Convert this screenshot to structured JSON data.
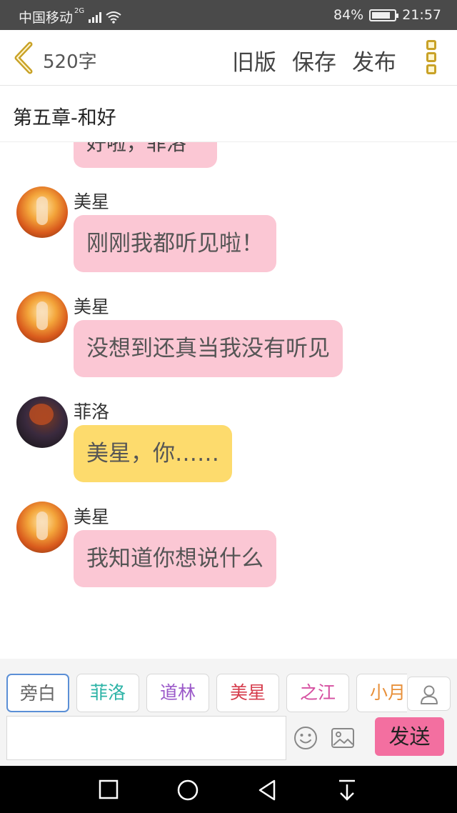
{
  "status_bar": {
    "carrier": "中国移动",
    "network": "2G",
    "battery_percent": "84%",
    "battery_level": 0.84,
    "time": "21:57"
  },
  "header": {
    "word_count": "520字",
    "actions": [
      "旧版",
      "保存",
      "发布"
    ],
    "accent_color": "#c9a227"
  },
  "chapter": {
    "title": "第五章-和好"
  },
  "chat": {
    "partial_message": "好啦，菲洛",
    "messages": [
      {
        "sender": "美星",
        "text": "刚刚我都听见啦！",
        "bubble": "pink",
        "avatar": "meixing-avatar"
      },
      {
        "sender": "美星",
        "text": "没想到还真当我没有听见",
        "bubble": "pink",
        "avatar": "meixing-avatar"
      },
      {
        "sender": "菲洛",
        "text": "美星，你……",
        "bubble": "yellow",
        "avatar": "feiluo-avatar"
      },
      {
        "sender": "美星",
        "text": "我知道你想说什么",
        "bubble": "pink",
        "avatar": "meixing-avatar"
      }
    ]
  },
  "characters": [
    {
      "name": "旁白",
      "color": "#666666"
    },
    {
      "name": "菲洛",
      "color": "#2bb3a6"
    },
    {
      "name": "道林",
      "color": "#9b59c9"
    },
    {
      "name": "美星",
      "color": "#d63c4c"
    },
    {
      "name": "之江",
      "color": "#d64fa0"
    },
    {
      "name": "小月",
      "color": "#e8903a"
    }
  ],
  "composer": {
    "input_value": "",
    "send_label": "发送",
    "icons": [
      "emoji-icon",
      "image-icon",
      "user-icon"
    ]
  },
  "colors": {
    "pink_bubble": "#fbc7d4",
    "yellow_bubble": "#fddb6d",
    "send_button": "#f36fa0"
  }
}
